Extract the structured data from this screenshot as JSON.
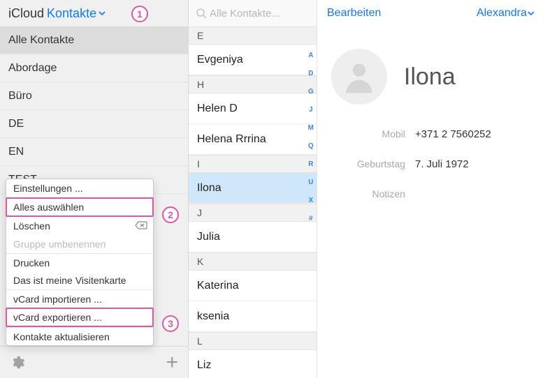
{
  "header": {
    "brand": "iCloud",
    "title": "Kontakte"
  },
  "groups": [
    {
      "label": "Alle Kontakte",
      "selected": true
    },
    {
      "label": "Abordage"
    },
    {
      "label": "Büro"
    },
    {
      "label": "DE"
    },
    {
      "label": "EN"
    },
    {
      "label": "TEST"
    }
  ],
  "context_menu": {
    "settings": "Einstellungen ...",
    "select_all": "Alles auswählen",
    "delete": "Löschen",
    "rename_group": "Gruppe umbenennen",
    "print": "Drucken",
    "my_card": "Das ist meine Visitenkarte",
    "vcard_import": "vCard importieren ...",
    "vcard_export": "vCard exportieren ...",
    "refresh": "Kontakte aktualisieren"
  },
  "list": {
    "search_placeholder": "Alle Kontakte...",
    "sections": [
      {
        "letter": "E",
        "items": [
          "Evgeniya"
        ]
      },
      {
        "letter": "H",
        "items": [
          "Helen D",
          "Helena Rrrina"
        ]
      },
      {
        "letter": "I",
        "items": [
          "Ilona"
        ]
      },
      {
        "letter": "J",
        "items": [
          "Julia"
        ]
      },
      {
        "letter": "K",
        "items": [
          "Katerina",
          "ksenia"
        ]
      },
      {
        "letter": "L",
        "items": [
          "Liz"
        ]
      }
    ],
    "selected": "Ilona",
    "alpha": [
      "A",
      "D",
      "G",
      "J",
      "M",
      "Q",
      "R",
      "U",
      "X",
      "#"
    ]
  },
  "detail": {
    "edit": "Bearbeiten",
    "account": "Alexandra",
    "name": "Ilona",
    "fields": {
      "mobile_label": "Mobil",
      "mobile_value": "+371 2 7560252",
      "birthday_label": "Geburtstag",
      "birthday_value": "7. Juli 1972",
      "notes_label": "Notizen"
    }
  },
  "badges": {
    "b1": "1",
    "b2": "2",
    "b3": "3"
  }
}
